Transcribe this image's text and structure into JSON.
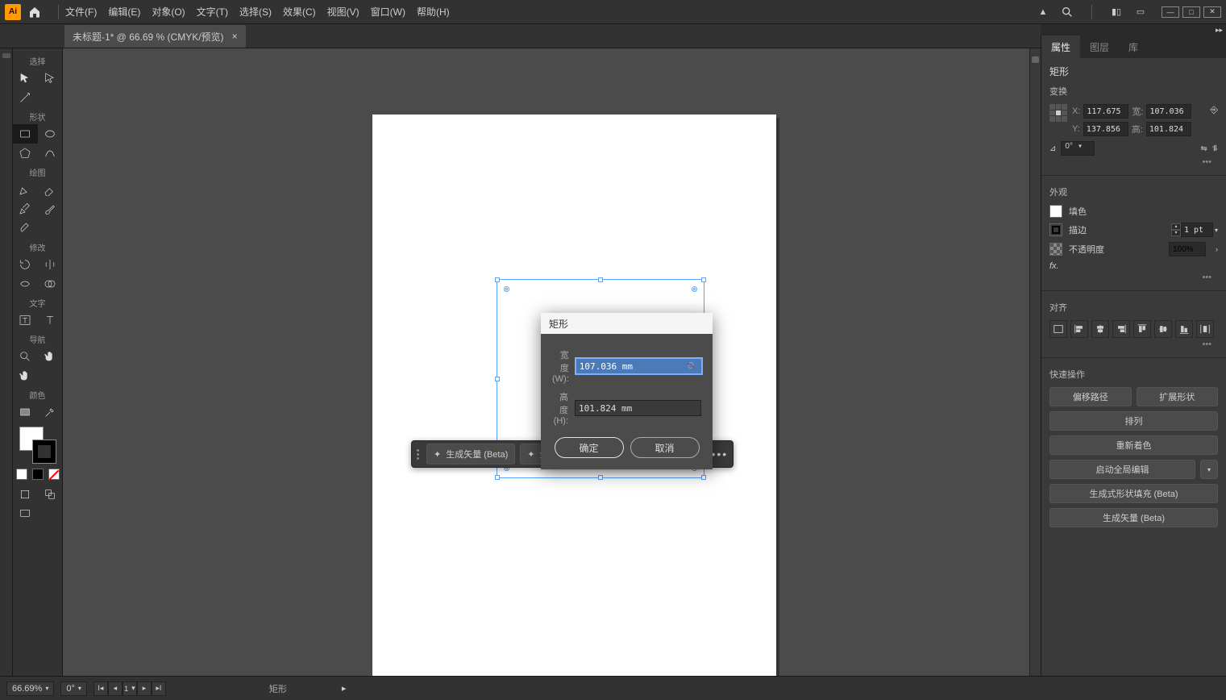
{
  "menu": {
    "items": [
      "文件(F)",
      "编辑(E)",
      "对象(O)",
      "文字(T)",
      "选择(S)",
      "效果(C)",
      "视图(V)",
      "窗口(W)",
      "帮助(H)"
    ]
  },
  "tab": {
    "title": "未标题-1* @ 66.69 % (CMYK/预览)"
  },
  "tools": {
    "g1": "选择",
    "g2": "形状",
    "g3": "绘图",
    "g4": "修改",
    "g5": "文字",
    "g6": "导航",
    "g7": "颜色"
  },
  "contextbar": {
    "btn1": "生成矢量 (Beta)",
    "btn2": "生成式形状填充 (Beta)"
  },
  "dialog": {
    "title": "矩形",
    "width_label": "宽度 (W):",
    "height_label": "高度 (H):",
    "width_value": "107.036 mm",
    "height_value": "101.824 mm",
    "ok": "确定",
    "cancel": "取消"
  },
  "panel": {
    "tabs": {
      "properties": "属性",
      "layers": "图层",
      "lib": "库"
    },
    "shape_title": "矩形",
    "transform_title": "变换",
    "x": "117.675",
    "y": "137.856",
    "w": "107.036",
    "h": "101.824",
    "x_lbl": "X:",
    "y_lbl": "Y:",
    "w_lbl": "宽:",
    "h_lbl": "高:",
    "angle": "0°",
    "appearance_title": "外观",
    "fill_label": "填色",
    "stroke_label": "描边",
    "stroke_value": "1 pt",
    "opacity_label": "不透明度",
    "opacity_value": "100%",
    "fx": "fx.",
    "align_title": "对齐",
    "quick_title": "快速操作",
    "qa": {
      "offset": "偏移路径",
      "expand": "扩展形状",
      "arrange": "排列",
      "recolor": "重新着色",
      "global_edit": "启动全局编辑",
      "gen_fill": "生成式形状填充 (Beta)",
      "gen_vector": "生成矢量 (Beta)"
    }
  },
  "status": {
    "zoom": "66.69%",
    "angle": "0°",
    "artboard": "1",
    "tool": "矩形"
  }
}
